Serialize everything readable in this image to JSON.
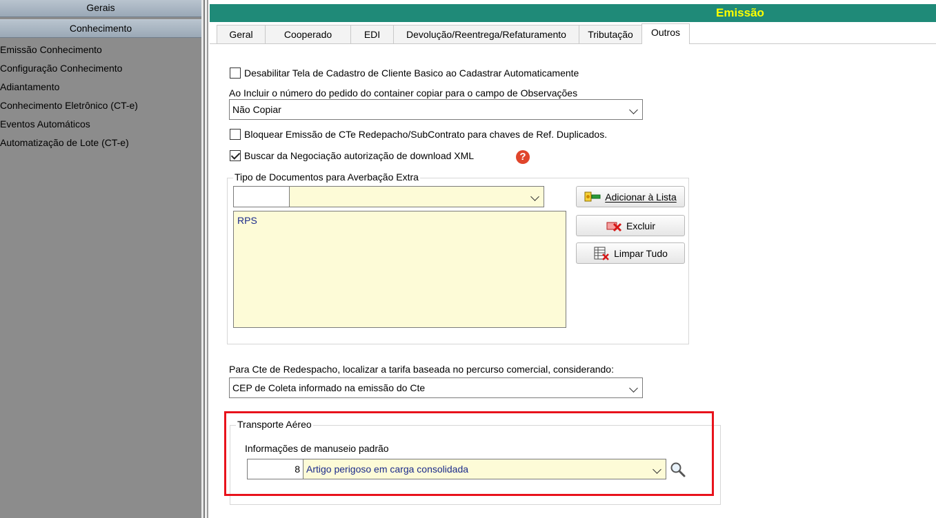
{
  "sidebar": {
    "header1": "Gerais",
    "header2": "Conhecimento",
    "items": [
      {
        "label": "Emissão Conhecimento"
      },
      {
        "label": "Configuração Conhecimento"
      },
      {
        "label": "Adiantamento"
      },
      {
        "label": "Conhecimento Eletrônico (CT-e)"
      },
      {
        "label": "Eventos Automáticos"
      },
      {
        "label": "Automatização de Lote (CT-e)"
      }
    ]
  },
  "header": {
    "title": "Emissão"
  },
  "tabs": [
    {
      "label": "Geral"
    },
    {
      "label": "Cooperado"
    },
    {
      "label": "EDI"
    },
    {
      "label": "Devolução/Reentrega/Refaturamento"
    },
    {
      "label": "Tributação"
    },
    {
      "label": "Outros"
    }
  ],
  "active_tab": "Outros",
  "form": {
    "cb_desabilitar": {
      "label": "Desabilitar Tela de Cadastro de Cliente Basico ao Cadastrar Automaticamente",
      "checked": false
    },
    "pedido_label": "Ao Incluir o número do pedido do container copiar para o campo de Observações",
    "pedido_value": "Não Copiar",
    "cb_bloquear": {
      "label": "Bloquear Emissão de CTe Redepacho/SubContrato para chaves de Ref. Duplicados.",
      "checked": false
    },
    "cb_buscar": {
      "label": "Buscar da Negociação autorização de download XML",
      "checked": true
    },
    "help_glyph": "?",
    "averbacao": {
      "legend": "Tipo de Documentos para Averbação Extra",
      "code_value": "",
      "select_value": "",
      "list_items": [
        "RPS"
      ],
      "btn_add": "Adicionar à Lista",
      "btn_excluir": "Excluir",
      "btn_limpar": "Limpar Tudo"
    },
    "redespacho_label": "Para Cte de Redespacho, localizar a tarifa baseada no percurso comercial, considerando:",
    "redespacho_value": "CEP de Coleta informado na emissão do Cte",
    "aereo": {
      "legend": "Transporte Aéreo",
      "manuseio_label": "Informações de manuseio padrão",
      "manuseio_code": "8",
      "manuseio_value": "Artigo perigoso em carga consolidada"
    }
  },
  "colors": {
    "title_bg": "#1f8a78",
    "title_fg": "#ffff00",
    "highlight": "#e8121b",
    "field_yellow": "#fdfbd7"
  }
}
